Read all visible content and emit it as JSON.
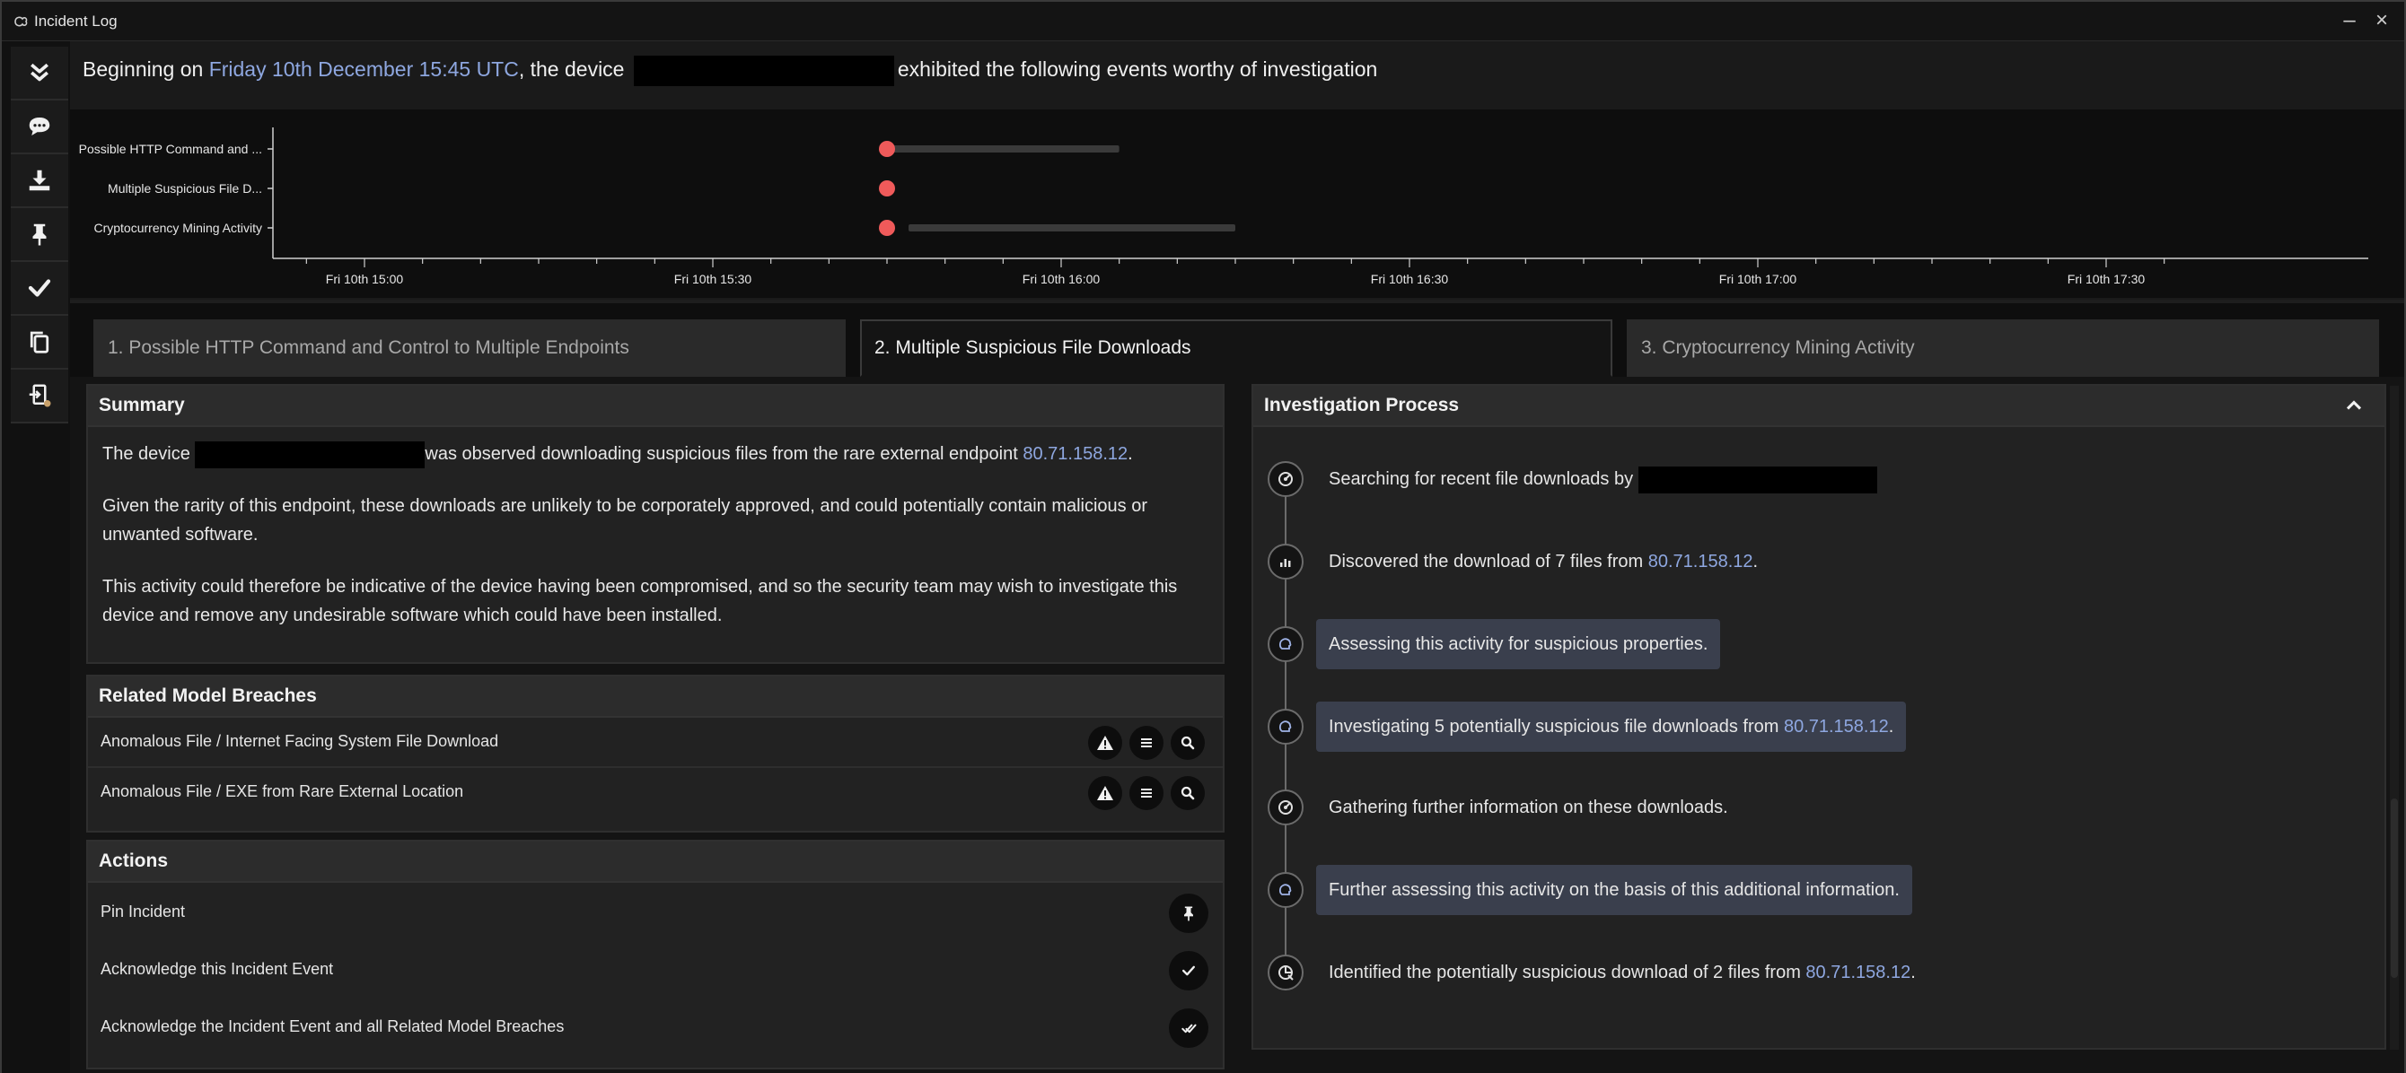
{
  "window": {
    "title": "Incident Log"
  },
  "toolbar": {
    "items": [
      {
        "name": "collapse-all-icon"
      },
      {
        "name": "comment-icon"
      },
      {
        "name": "download-icon"
      },
      {
        "name": "pin-icon"
      },
      {
        "name": "checkmark-icon"
      },
      {
        "name": "copy-icon"
      },
      {
        "name": "export-icon"
      }
    ]
  },
  "header": {
    "prefix": "Beginning on ",
    "date": "Friday 10th December 15:45 UTC",
    "middle": ", the device",
    "suffix": "exhibited the following events worthy of investigation"
  },
  "chart_data": {
    "type": "timeline",
    "categories": [
      "Possible HTTP Command and ...",
      "Multiple Suspicious File D...",
      "Cryptocurrency Mining Activity"
    ],
    "x_tick_labels": [
      "Fri 10th 15:00",
      "Fri 10th 15:30",
      "Fri 10th 16:00",
      "Fri 10th 16:30",
      "Fri 10th 17:00",
      "Fri 10th 17:30"
    ],
    "x_range": [
      "15:00",
      "17:30"
    ],
    "events": [
      {
        "category": "Possible HTTP Command and ...",
        "start": "15:45",
        "end": "16:05"
      },
      {
        "category": "Multiple Suspicious File D...",
        "start": "15:45",
        "end": "15:45"
      },
      {
        "category": "Cryptocurrency Mining Activity",
        "start": "15:45",
        "end": "16:15"
      }
    ],
    "marker_color": "#ef5a5a",
    "bar_color": "#3a3a3a"
  },
  "tabs": [
    {
      "label": "1. Possible HTTP Command and Control to Multiple Endpoints"
    },
    {
      "label": "2. Multiple Suspicious File Downloads"
    },
    {
      "label": "3. Cryptocurrency Mining Activity"
    }
  ],
  "summary": {
    "title": "Summary",
    "p1_prefix": "The device",
    "p1_suffix": "was observed downloading suspicious files from the rare external endpoint ",
    "endpoint": "80.71.158.12",
    "p1_end": ".",
    "p2": "Given the rarity of this endpoint, these downloads are unlikely to be corporately approved, and could potentially contain malicious or unwanted software.",
    "p3": "This activity could therefore be indicative of the device having been compromised, and so the security team may wish to investigate this device and remove any undesirable software which could have been installed."
  },
  "breaches": {
    "title": "Related Model Breaches",
    "items": [
      {
        "label": "Anomalous File / Internet Facing System File Download"
      },
      {
        "label": "Anomalous File / EXE from Rare External Location"
      }
    ]
  },
  "actions": {
    "title": "Actions",
    "items": [
      {
        "label": "Pin Incident"
      },
      {
        "label": "Acknowledge this Incident Event"
      },
      {
        "label": "Acknowledge the Incident Event and all Related Model Breaches"
      }
    ]
  },
  "investigation": {
    "title": "Investigation Process",
    "steps": [
      {
        "text": "Searching for recent file downloads by",
        "icon": "search-step-icon"
      },
      {
        "text": "Discovered the download of 7 files from ",
        "link": "80.71.158.12",
        "end": ".",
        "icon": "chart-step-icon"
      },
      {
        "text": "Assessing this activity for suspicious properties.",
        "icon": "brain-step-icon"
      },
      {
        "text": "Investigating 5 potentially suspicious file downloads from ",
        "link": "80.71.158.12",
        "end": ".",
        "icon": "brain-step-icon"
      },
      {
        "text": "Gathering further information on these downloads.",
        "icon": "search-step-icon"
      },
      {
        "text": "Further assessing this activity on the basis of this additional information.",
        "icon": "brain-step-icon"
      },
      {
        "text": "Identified the potentially suspicious download of 2 files from ",
        "link": "80.71.158.12",
        "end": ".",
        "icon": "result-step-icon"
      }
    ]
  }
}
